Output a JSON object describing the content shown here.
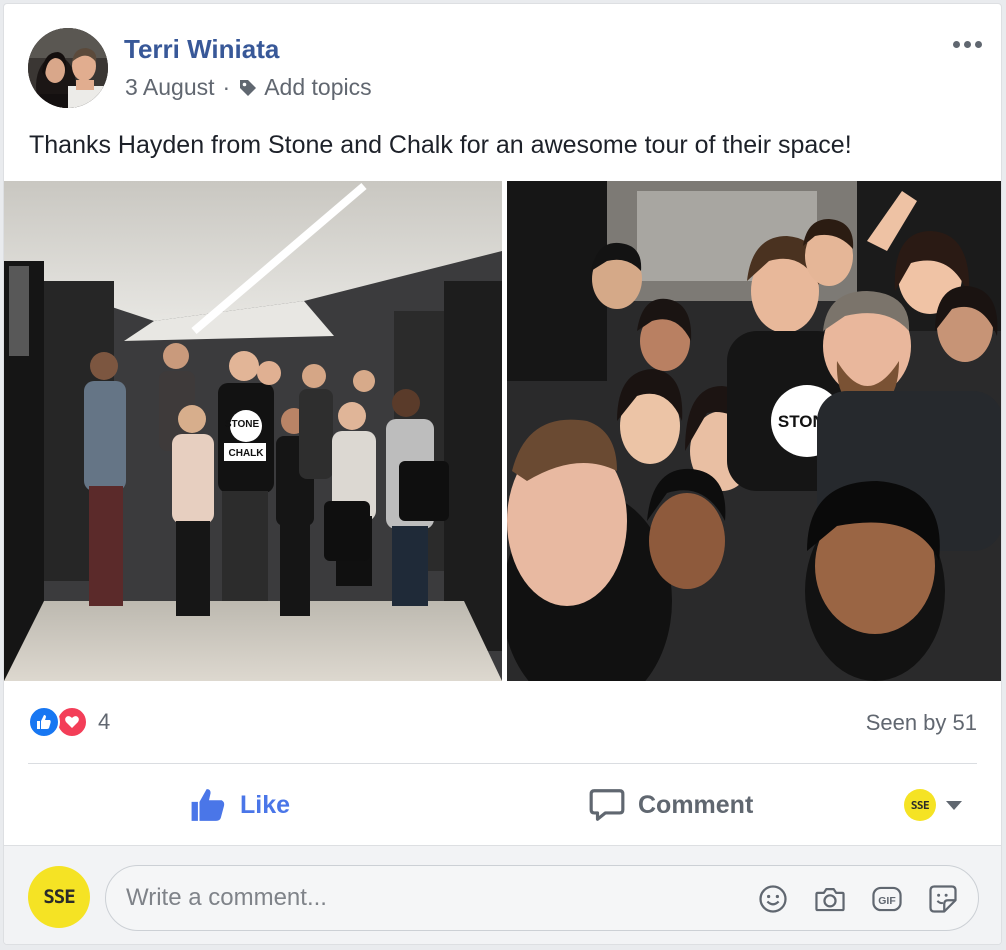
{
  "post": {
    "author": "Terri Winiata",
    "date": "3 August",
    "separator": "·",
    "add_topics": "Add topics",
    "text": "Thanks Hayden from Stone and Chalk for an awesome tour of their space!",
    "photo_left_sign_text": "STONE CHALK",
    "photo_right_shirt_text": "STONE"
  },
  "reactions": {
    "types": [
      "like",
      "love"
    ],
    "count": "4",
    "seen": "Seen by 51"
  },
  "actions": {
    "like_label": "Like",
    "comment_label": "Comment",
    "page_logo_text": "SSE"
  },
  "composer": {
    "placeholder": "Write a comment...",
    "logo_text": "SSE",
    "icons": [
      "emoji-icon",
      "camera-icon",
      "gif-icon",
      "sticker-icon"
    ],
    "gif_text": "GIF"
  },
  "colors": {
    "author": "#385898",
    "like_blue": "#4a76e8",
    "love_red": "#f33e58",
    "brand_yellow": "#f5e324"
  }
}
